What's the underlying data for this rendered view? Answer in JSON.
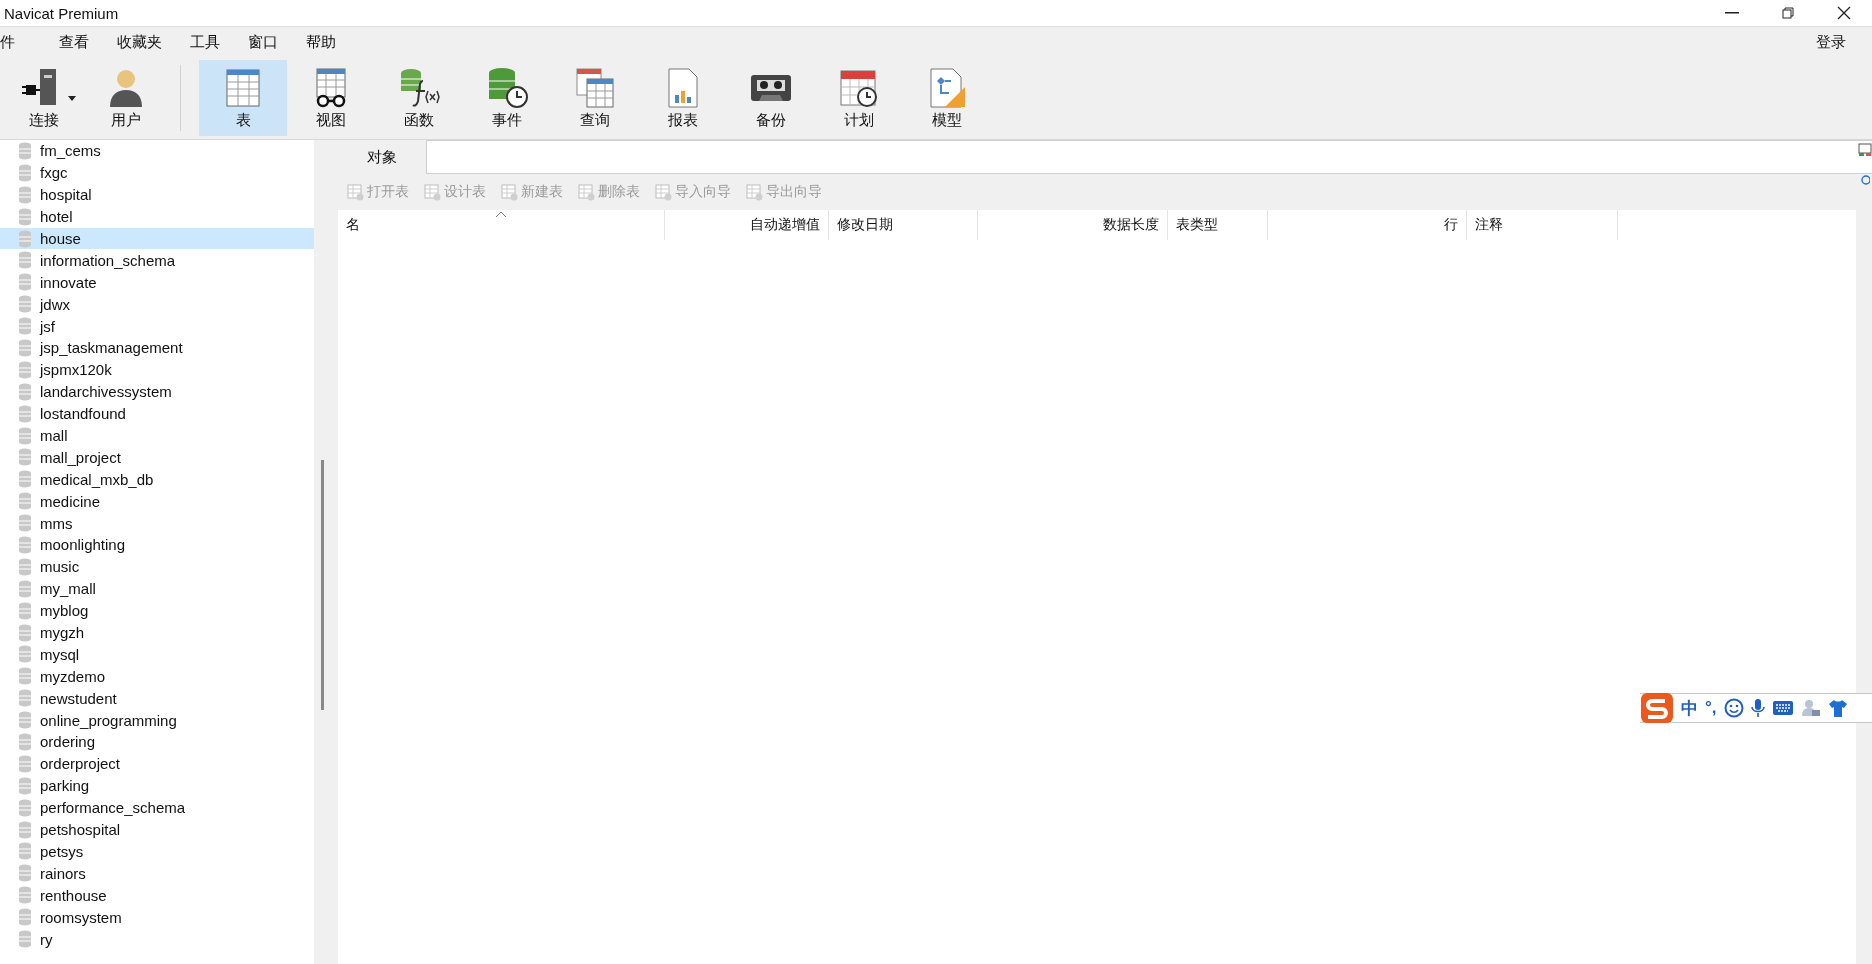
{
  "window": {
    "title": "Navicat Premium"
  },
  "menu": [
    "件",
    "查看",
    "收藏夹",
    "工具",
    "窗口",
    "帮助"
  ],
  "login": "登录",
  "toolbar": [
    {
      "kind": "connect",
      "label": "连接",
      "selected": false
    },
    {
      "kind": "user",
      "label": "用户",
      "selected": false
    },
    {
      "kind": "table",
      "label": "表",
      "selected": true
    },
    {
      "kind": "view",
      "label": "视图",
      "selected": false
    },
    {
      "kind": "function",
      "label": "函数",
      "selected": false
    },
    {
      "kind": "event",
      "label": "事件",
      "selected": false
    },
    {
      "kind": "query",
      "label": "查询",
      "selected": false
    },
    {
      "kind": "report",
      "label": "报表",
      "selected": false
    },
    {
      "kind": "backup",
      "label": "备份",
      "selected": false
    },
    {
      "kind": "schedule",
      "label": "计划",
      "selected": false
    },
    {
      "kind": "model",
      "label": "模型",
      "selected": false
    }
  ],
  "sidebar": {
    "items": [
      {
        "label": "fm_cems",
        "selected": false
      },
      {
        "label": "fxgc",
        "selected": false
      },
      {
        "label": "hospital",
        "selected": false
      },
      {
        "label": "hotel",
        "selected": false
      },
      {
        "label": "house",
        "selected": true
      },
      {
        "label": "information_schema",
        "selected": false
      },
      {
        "label": "innovate",
        "selected": false
      },
      {
        "label": "jdwx",
        "selected": false
      },
      {
        "label": "jsf",
        "selected": false
      },
      {
        "label": "jsp_taskmanagement",
        "selected": false
      },
      {
        "label": "jspmx120k",
        "selected": false
      },
      {
        "label": "landarchivessystem",
        "selected": false
      },
      {
        "label": "lostandfound",
        "selected": false
      },
      {
        "label": "mall",
        "selected": false
      },
      {
        "label": "mall_project",
        "selected": false
      },
      {
        "label": "medical_mxb_db",
        "selected": false
      },
      {
        "label": "medicine",
        "selected": false
      },
      {
        "label": "mms",
        "selected": false
      },
      {
        "label": "moonlighting",
        "selected": false
      },
      {
        "label": "music",
        "selected": false
      },
      {
        "label": "my_mall",
        "selected": false
      },
      {
        "label": "myblog",
        "selected": false
      },
      {
        "label": "mygzh",
        "selected": false
      },
      {
        "label": "mysql",
        "selected": false
      },
      {
        "label": "myzdemo",
        "selected": false
      },
      {
        "label": "newstudent",
        "selected": false
      },
      {
        "label": "online_programming",
        "selected": false
      },
      {
        "label": "ordering",
        "selected": false
      },
      {
        "label": "orderproject",
        "selected": false
      },
      {
        "label": "parking",
        "selected": false
      },
      {
        "label": "performance_schema",
        "selected": false
      },
      {
        "label": "petshospital",
        "selected": false
      },
      {
        "label": "petsys",
        "selected": false
      },
      {
        "label": "rainors",
        "selected": false
      },
      {
        "label": "renthouse",
        "selected": false
      },
      {
        "label": "roomsystem",
        "selected": false
      },
      {
        "label": "ry",
        "selected": false
      }
    ]
  },
  "tabs": [
    {
      "label": "对象",
      "selected": true
    }
  ],
  "actions": [
    {
      "label": "打开表",
      "disabled": true
    },
    {
      "label": "设计表",
      "disabled": true
    },
    {
      "label": "新建表",
      "disabled": true
    },
    {
      "label": "删除表",
      "disabled": true
    },
    {
      "label": "导入向导",
      "disabled": true
    },
    {
      "label": "导出向导",
      "disabled": true
    }
  ],
  "table": {
    "columns": [
      {
        "label": "名",
        "kind": "text",
        "sorted": true
      },
      {
        "label": "自动递增值",
        "kind": "number",
        "sorted": false
      },
      {
        "label": "修改日期",
        "kind": "text",
        "sorted": false
      },
      {
        "label": "数据长度",
        "kind": "number",
        "sorted": false
      },
      {
        "label": "表类型",
        "kind": "text",
        "sorted": false
      },
      {
        "label": "行",
        "kind": "number",
        "sorted": false
      },
      {
        "label": "注释",
        "kind": "text",
        "sorted": false
      }
    ]
  },
  "ime_bar": {
    "mode": "中",
    "punctuation": "°,"
  }
}
